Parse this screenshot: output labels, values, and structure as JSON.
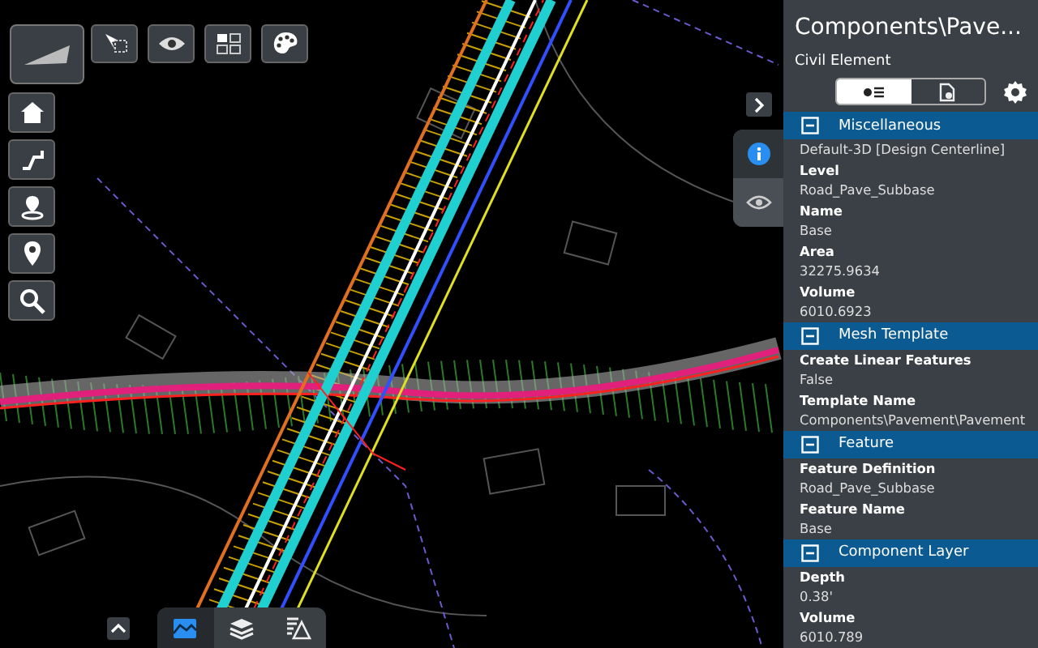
{
  "map_toolbar": {
    "tools": [
      {
        "kind": "terrain"
      },
      {
        "kind": "select"
      },
      {
        "kind": "visibility"
      },
      {
        "kind": "layout"
      },
      {
        "kind": "palette"
      }
    ],
    "nav": [
      {
        "kind": "home"
      },
      {
        "kind": "path"
      },
      {
        "kind": "location"
      },
      {
        "kind": "pin"
      },
      {
        "kind": "search"
      }
    ]
  },
  "side_tabs": [
    {
      "kind": "info",
      "selected": true
    },
    {
      "kind": "visibility",
      "selected": false
    }
  ],
  "bottom_tabs": [
    {
      "kind": "map",
      "selected": true
    },
    {
      "kind": "layers",
      "selected": false
    },
    {
      "kind": "issues",
      "selected": false
    }
  ],
  "panel": {
    "title": "Components\\Pave...",
    "subtitle": "Civil Element",
    "view_toggle": [
      {
        "kind": "properties",
        "selected": true
      },
      {
        "kind": "document",
        "selected": false
      }
    ],
    "sections": [
      {
        "title": "Miscellaneous",
        "expanded": true,
        "properties": [
          {
            "value": "Default-3D [Design Centerline]"
          },
          {
            "label": "Level",
            "value": "Road_Pave_Subbase"
          },
          {
            "label": "Name",
            "value": "Base"
          },
          {
            "label": "Area",
            "value": "32275.9634"
          },
          {
            "label": "Volume",
            "value": "6010.6923"
          }
        ]
      },
      {
        "title": "Mesh Template",
        "expanded": true,
        "properties": [
          {
            "label": "Create Linear Features",
            "value": "False"
          },
          {
            "label": "Template Name",
            "value": "Components\\Pavement\\Pavement"
          }
        ]
      },
      {
        "title": "Feature",
        "expanded": true,
        "properties": [
          {
            "label": "Feature Definition",
            "value": "Road_Pave_Subbase"
          },
          {
            "label": "Feature Name",
            "value": "Base"
          }
        ]
      },
      {
        "title": "Component Layer",
        "expanded": true,
        "properties": [
          {
            "label": "Depth",
            "value": "0.38'"
          },
          {
            "label": "Volume",
            "value": "6010.789"
          }
        ]
      }
    ]
  }
}
